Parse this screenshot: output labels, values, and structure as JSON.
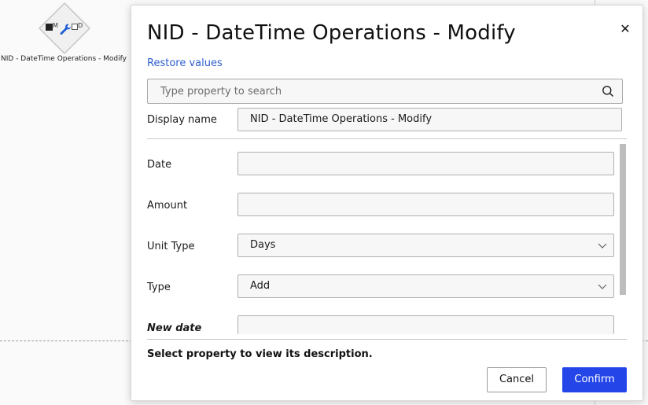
{
  "canvas": {
    "node": {
      "check_label": "M",
      "box_label": "D",
      "caption": "NID - DateTime Operations - Modify"
    }
  },
  "modal": {
    "title": "NID - DateTime Operations - Modify",
    "close_symbol": "✕",
    "restore_label": "Restore values",
    "search": {
      "placeholder": "Type property to search",
      "value": ""
    },
    "display_name": {
      "label": "Display name",
      "value": "NID - DateTime Operations - Modify"
    },
    "properties": [
      {
        "label": "Date",
        "value": ""
      },
      {
        "label": "Amount",
        "value": ""
      },
      {
        "label": "Unit Type",
        "value": "Days"
      },
      {
        "label": "Type",
        "value": "Add"
      },
      {
        "label": "New date",
        "value": ""
      }
    ],
    "description": "Select property to view its description.",
    "buttons": {
      "cancel": "Cancel",
      "confirm": "Confirm"
    }
  },
  "colors": {
    "accent": "#2446e8",
    "link": "#2f5fd0"
  },
  "icons": [
    "wrench-icon",
    "search-icon",
    "close-icon",
    "chevron-down-icon"
  ]
}
